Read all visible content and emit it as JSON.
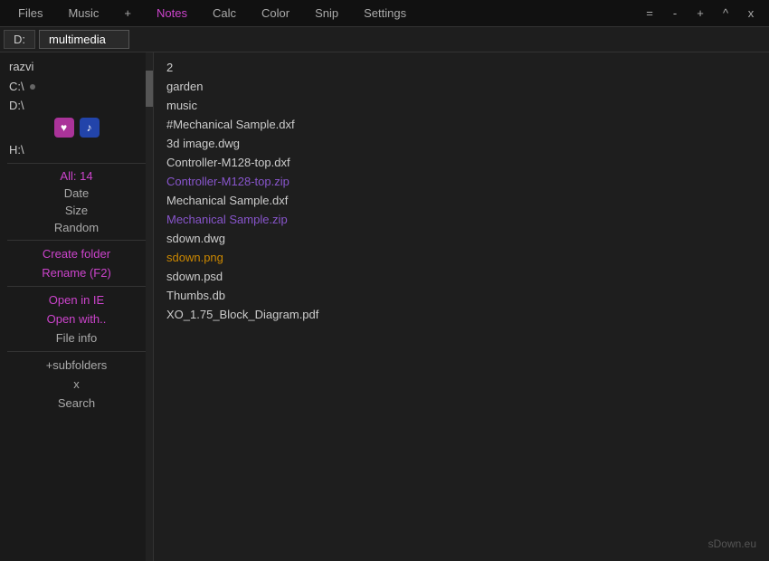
{
  "titlebar": {
    "tabs": [
      {
        "id": "files",
        "label": "Files",
        "active": false
      },
      {
        "id": "music",
        "label": "Music",
        "active": false
      },
      {
        "id": "plus",
        "label": "+",
        "active": false
      },
      {
        "id": "notes",
        "label": "Notes",
        "active": true
      },
      {
        "id": "calc",
        "label": "Calc",
        "active": false
      },
      {
        "id": "color",
        "label": "Color",
        "active": false
      },
      {
        "id": "snip",
        "label": "Snip",
        "active": false
      },
      {
        "id": "settings",
        "label": "Settings",
        "active": false
      }
    ],
    "winbtns": [
      {
        "id": "eq",
        "label": "="
      },
      {
        "id": "min",
        "label": "-"
      },
      {
        "id": "max",
        "label": "+"
      },
      {
        "id": "restore",
        "label": "^"
      },
      {
        "id": "close",
        "label": "x"
      }
    ]
  },
  "addressbar": {
    "drive": "D:",
    "path": "multimedia"
  },
  "sidebar": {
    "user": "razvi",
    "drives": [
      {
        "label": "C:\\",
        "dot": true
      },
      {
        "label": "D:\\",
        "dot": false
      },
      {
        "label": "H:\\",
        "dot": false
      }
    ],
    "stat": "All: 14",
    "sort_labels": [
      "Date",
      "Size",
      "Random"
    ],
    "actions": [
      {
        "label": "Create folder",
        "color": "purple"
      },
      {
        "label": "Rename (F2)",
        "color": "purple"
      },
      {
        "label": "Open in IE",
        "color": "purple"
      },
      {
        "label": "Open with..",
        "color": "purple"
      },
      {
        "label": "File info",
        "color": "gray"
      },
      {
        "label": "+subfolders",
        "color": "gray"
      },
      {
        "label": "x",
        "color": "gray"
      },
      {
        "label": "Search",
        "color": "gray"
      }
    ]
  },
  "files": [
    {
      "name": "2",
      "type": "number"
    },
    {
      "name": "garden",
      "type": "folder"
    },
    {
      "name": "music",
      "type": "folder"
    },
    {
      "name": "#Mechanical Sample.dxf",
      "type": "file"
    },
    {
      "name": "3d image.dwg",
      "type": "file"
    },
    {
      "name": "Controller-M128-top.dxf",
      "type": "file"
    },
    {
      "name": "Controller-M128-top.zip",
      "type": "zip"
    },
    {
      "name": "Mechanical Sample.dxf",
      "type": "file"
    },
    {
      "name": "Mechanical Sample.zip",
      "type": "zip"
    },
    {
      "name": "sdown.dwg",
      "type": "file"
    },
    {
      "name": "sdown.png",
      "type": "png"
    },
    {
      "name": "sdown.psd",
      "type": "file"
    },
    {
      "name": "Thumbs.db",
      "type": "file"
    },
    {
      "name": "XO_1.75_Block_Diagram.pdf",
      "type": "file"
    }
  ],
  "watermark": "sDown.eu"
}
